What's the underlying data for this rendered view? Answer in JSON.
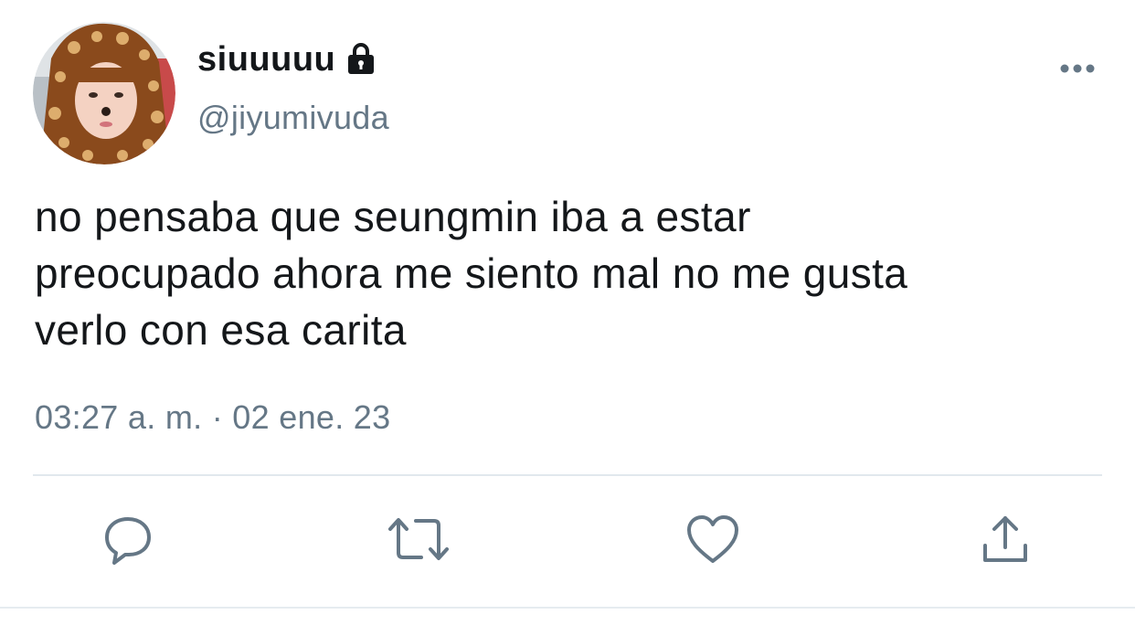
{
  "user": {
    "display_name": "siuuuuu",
    "handle": "@jiyumivuda",
    "protected_icon": "lock-icon"
  },
  "tweet": {
    "text_lines": [
      "no pensaba que seungmin iba a estar",
      "preocupado ahora me siento mal no me gusta",
      "verlo con esa carita"
    ],
    "timestamp": "03:27 a. m. · 02 ene. 23"
  },
  "actions": [
    {
      "name": "reply",
      "icon": "reply-icon"
    },
    {
      "name": "retweet",
      "icon": "retweet-icon"
    },
    {
      "name": "like",
      "icon": "heart-icon"
    },
    {
      "name": "share",
      "icon": "share-icon"
    }
  ],
  "colors": {
    "text_primary": "#14171a",
    "text_secondary": "#657786",
    "icon_gray": "#657786",
    "divider": "#e1e8ed"
  }
}
